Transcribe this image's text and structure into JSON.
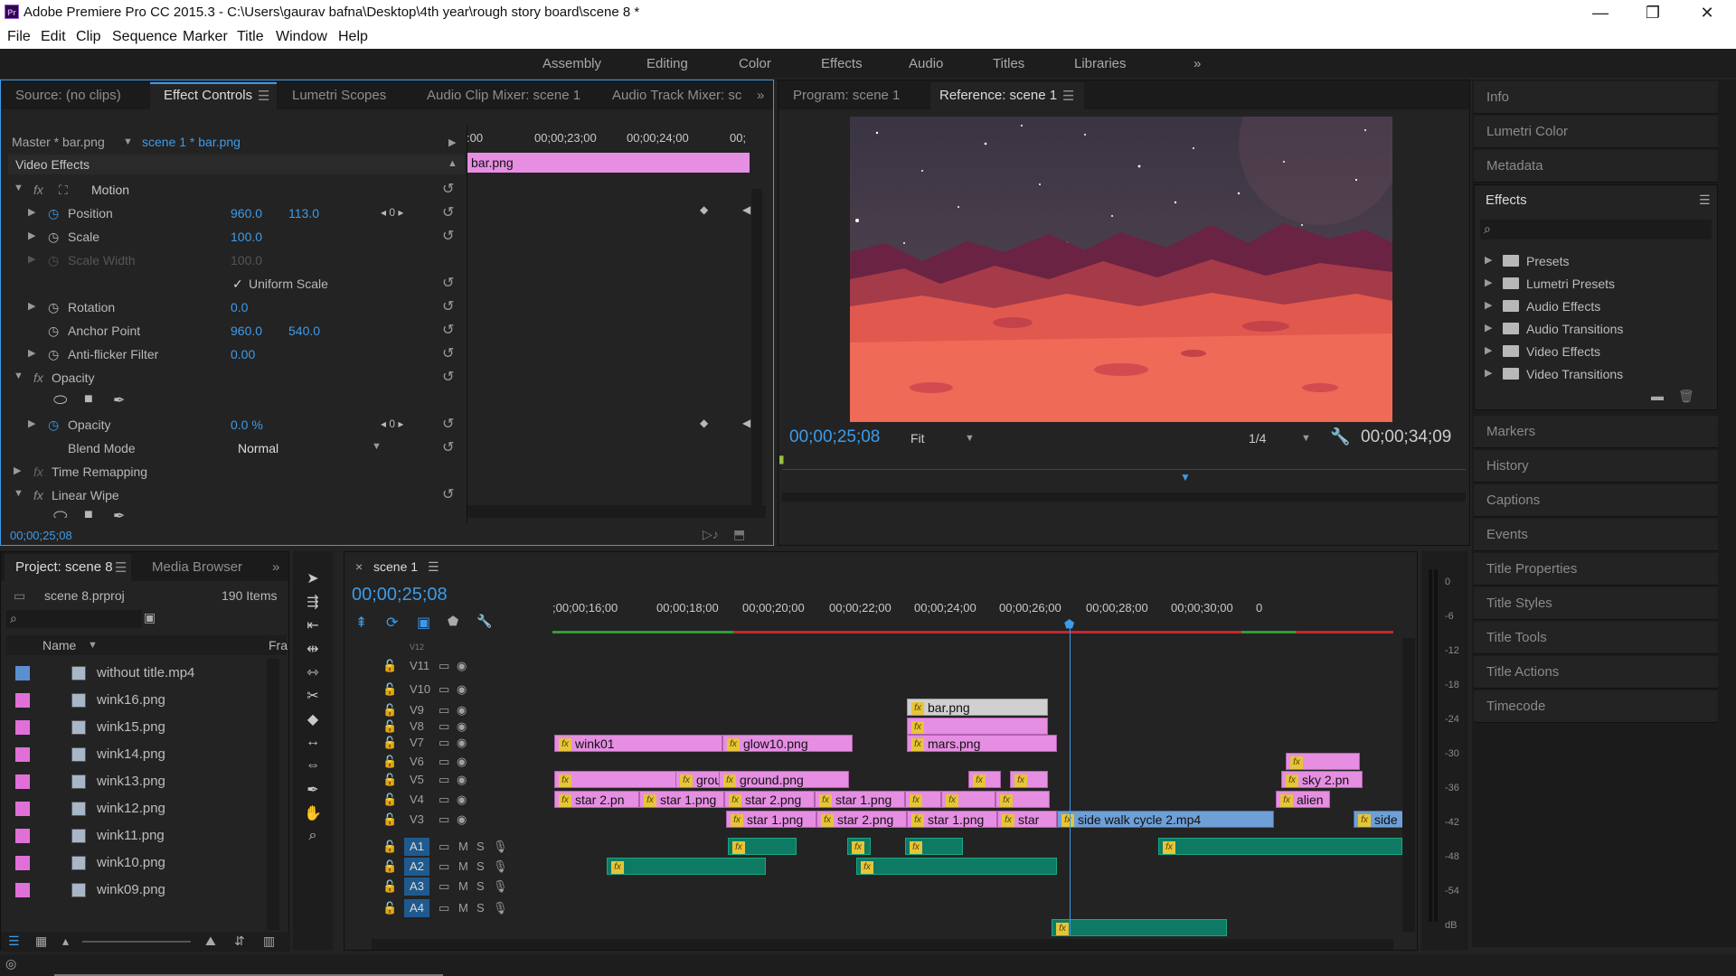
{
  "window": {
    "title": "Adobe Premiere Pro CC 2015.3 - C:\\Users\\gaurav bafna\\Desktop\\4th year\\rough story board\\scene 8 *",
    "minimize": "—",
    "restore": "❐",
    "close": "✕"
  },
  "menu": [
    "File",
    "Edit",
    "Clip",
    "Sequence",
    "Marker",
    "Title",
    "Window",
    "Help"
  ],
  "workspaces": [
    "Assembly",
    "Editing",
    "Color",
    "Effects",
    "Audio",
    "Titles",
    "Libraries",
    "»"
  ],
  "source_panel": {
    "tabs": [
      "Source: (no clips)",
      "Effect Controls",
      "Lumetri Scopes",
      "Audio Clip Mixer: scene 1",
      "Audio Track Mixer: sc"
    ],
    "more": "»",
    "master": "Master * bar.png",
    "sequence_clip": "scene 1 * bar.png",
    "ruler": [
      ":00",
      "00;00;23;00",
      "00;00;24;00",
      "00;"
    ],
    "clip_label": "bar.png",
    "video_effects": "Video Effects",
    "motion": "Motion",
    "position_label": "Position",
    "position_x": "960.0",
    "position_y": "113.0",
    "scale_label": "Scale",
    "scale_value": "100.0",
    "scale_width_label": "Scale Width",
    "scale_width_value": "100.0",
    "uniform_scale": "Uniform Scale",
    "rotation_label": "Rotation",
    "rotation_value": "0.0",
    "anchor_label": "Anchor Point",
    "anchor_x": "960.0",
    "anchor_y": "540.0",
    "antiflicker_label": "Anti-flicker Filter",
    "antiflicker_value": "0.00",
    "opacity_section": "Opacity",
    "opacity_label": "Opacity",
    "opacity_value": "0.0 %",
    "blend_label": "Blend Mode",
    "blend_value": "Normal",
    "time_remap": "Time Remapping",
    "linear_wipe": "Linear Wipe",
    "timecode": "00;00;25;08",
    "fx": "fx",
    "kf_nav": "◂ 0 ▸"
  },
  "program_panel": {
    "tabs": [
      "Program: scene 1",
      "Reference: scene 1"
    ],
    "timecode": "00;00;25;08",
    "fit": "Fit",
    "resolution": "1/4",
    "duration": "00;00;34;09"
  },
  "right_panels": [
    "Info",
    "Lumetri Color",
    "Metadata"
  ],
  "effects_panel": {
    "title": "Effects",
    "items": [
      "Presets",
      "Lumetri Presets",
      "Audio Effects",
      "Audio Transitions",
      "Video Effects",
      "Video Transitions"
    ]
  },
  "right_panels_lower": [
    "Markers",
    "History",
    "Captions",
    "Events",
    "Title Properties",
    "Title Styles",
    "Title Tools",
    "Title Actions",
    "Timecode"
  ],
  "project_panel": {
    "tabs": [
      "Project: scene 8",
      "Media Browser"
    ],
    "more": "»",
    "file": "scene 8.prproj",
    "count": "190 Items",
    "col_name": "Name",
    "col_fr": "Fra",
    "items": [
      {
        "name": "without title.mp4",
        "color": "#5b8fd0"
      },
      {
        "name": "wink16.png",
        "color": "#e070d8"
      },
      {
        "name": "wink15.png",
        "color": "#e070d8"
      },
      {
        "name": "wink14.png",
        "color": "#e070d8"
      },
      {
        "name": "wink13.png",
        "color": "#e070d8"
      },
      {
        "name": "wink12.png",
        "color": "#e070d8"
      },
      {
        "name": "wink11.png",
        "color": "#e070d8"
      },
      {
        "name": "wink10.png",
        "color": "#e070d8"
      },
      {
        "name": "wink09.png",
        "color": "#e070d8"
      }
    ]
  },
  "timeline": {
    "tab": "scene 1",
    "close": "×",
    "timecode": "00;00;25;08",
    "ruler": [
      ";00;00;16;00",
      "00;00;18;00",
      "00;00;20;00",
      "00;00;22;00",
      "00;00;24;00",
      "00;00;26;00",
      "00;00;28;00",
      "00;00;30;00",
      "0"
    ],
    "video_tracks": [
      "V11",
      "V10",
      "V9",
      "V8",
      "V7",
      "V6",
      "V5",
      "V4",
      "V3"
    ],
    "audio_tracks": [
      "A1",
      "A2",
      "A3",
      "A4"
    ],
    "partial_track": "V12",
    "mute": "M",
    "solo": "S",
    "clips": {
      "bar": "bar.png",
      "wink01": "wink01",
      "glow10": "glow10.png",
      "mars": "mars.png",
      "ground1": "ground.png",
      "ground2": "ground.png",
      "star2a": "star 2.pn",
      "star1a": "star 1.png",
      "star2b": "star 2.png",
      "star1b": "star 1.png",
      "star1c": "star 1.png",
      "star2c": "star 2.png",
      "star1d": "star 1.png",
      "star_trunc": "star",
      "sidewalk": "side walk cycle 2.mp4",
      "sky2": "sky 2.pn",
      "alien": "alien",
      "side_trunc": "side",
      "fx": "fx"
    }
  },
  "meter_labels": [
    "0",
    "-6",
    "-12",
    "-18",
    "-24",
    "-30",
    "-36",
    "-42",
    "-48",
    "-54",
    "dB"
  ],
  "colors": {
    "accent": "#3d9be9",
    "clip_video": "#e58ee2",
    "clip_audio": "#0f7a63",
    "clip_selected_video": "#6e9fd6"
  }
}
